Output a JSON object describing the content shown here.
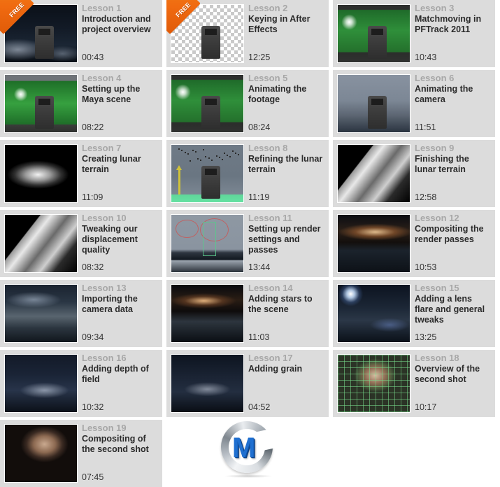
{
  "badge": {
    "free_label": "FREE"
  },
  "lessons": [
    {
      "number": "Lesson 1",
      "title": "Introduction and project overview",
      "duration": "00:43",
      "free": true,
      "scene": "sc-moonnight"
    },
    {
      "number": "Lesson 2",
      "title": "Keying in After Effects",
      "duration": "12:25",
      "free": true,
      "scene": "sc-checker"
    },
    {
      "number": "Lesson 3",
      "title": "Matchmoving in PFTrack 2011",
      "duration": "10:43",
      "free": false,
      "scene": "sc-green"
    },
    {
      "number": "Lesson 4",
      "title": "Setting up the Maya scene",
      "duration": "08:22",
      "free": false,
      "scene": "sc-green2"
    },
    {
      "number": "Lesson 5",
      "title": "Animating the footage",
      "duration": "08:24",
      "free": false,
      "scene": "sc-green"
    },
    {
      "number": "Lesson 6",
      "title": "Animating the camera",
      "duration": "11:51",
      "free": false,
      "scene": "sc-bluegrey"
    },
    {
      "number": "Lesson 7",
      "title": "Creating lunar terrain",
      "duration": "11:09",
      "free": false,
      "scene": "sc-lunar-bw"
    },
    {
      "number": "Lesson 8",
      "title": "Refining the lunar terrain",
      "duration": "11:19",
      "free": false,
      "scene": "sc-maya-viewport"
    },
    {
      "number": "Lesson 9",
      "title": "Finishing the lunar terrain",
      "duration": "12:58",
      "free": false,
      "scene": "sc-lunar-ridge"
    },
    {
      "number": "Lesson 10",
      "title": "Tweaking our displacement quality",
      "duration": "08:32",
      "free": false,
      "scene": "sc-lunar-ridge"
    },
    {
      "number": "Lesson 11",
      "title": "Setting up render settings and passes",
      "duration": "13:44",
      "free": false,
      "scene": "sc-render-setup"
    },
    {
      "number": "Lesson 12",
      "title": "Compositing the render passes",
      "duration": "10:53",
      "free": false,
      "scene": "sc-galaxy"
    },
    {
      "number": "Lesson 13",
      "title": "Importing the camera data",
      "duration": "09:34",
      "free": false,
      "scene": "sc-lunar-cam"
    },
    {
      "number": "Lesson 14",
      "title": "Adding stars to the scene",
      "duration": "11:03",
      "free": false,
      "scene": "sc-stars"
    },
    {
      "number": "Lesson 15",
      "title": "Adding a lens flare and general tweaks",
      "duration": "13:25",
      "free": false,
      "scene": "sc-lensflare"
    },
    {
      "number": "Lesson 16",
      "title": "Adding depth of field",
      "duration": "10:32",
      "free": false,
      "scene": "sc-dof"
    },
    {
      "number": "Lesson 17",
      "title": "Adding grain",
      "duration": "04:52",
      "free": false,
      "scene": "sc-grain"
    },
    {
      "number": "Lesson 18",
      "title": "Overview of the second shot",
      "duration": "10:17",
      "free": false,
      "scene": "sc-helmet-grid"
    },
    {
      "number": "Lesson 19",
      "title": "Compositing of the second shot",
      "duration": "07:45",
      "free": false,
      "scene": "sc-helmet"
    }
  ],
  "footer": {
    "logo_name": "cg-logo",
    "logo_letter": "M",
    "colors": {
      "logo_blue": "#1f6fd0",
      "logo_silver": "#b9bfc6"
    }
  },
  "theme": {
    "card_bg": "#dcdcdc",
    "page_bg": "#ffffff",
    "lesson_number_color": "#a7a7a7",
    "title_color": "#2b2b2b",
    "badge_orange": "#f06a10"
  }
}
